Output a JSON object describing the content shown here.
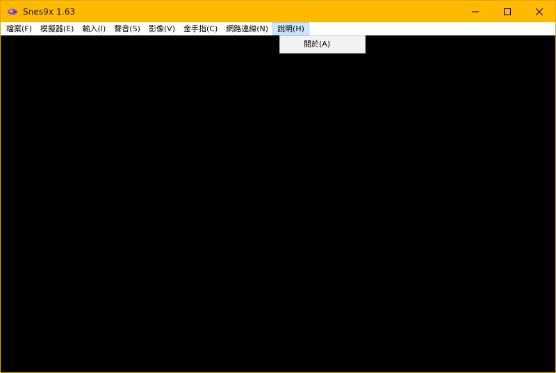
{
  "window": {
    "title": "Snes9x 1.63",
    "icon": "snes9x-app-icon",
    "controls": [
      "minimize-icon",
      "maximize-icon",
      "close-icon"
    ]
  },
  "menubar": {
    "items": [
      {
        "label": "檔案(F)"
      },
      {
        "label": "模擬器(E)"
      },
      {
        "label": "輸入(I)"
      },
      {
        "label": "聲音(S)"
      },
      {
        "label": "影像(V)"
      },
      {
        "label": "金手指(C)"
      },
      {
        "label": "網路連線(N)"
      },
      {
        "label": "說明(H)"
      }
    ],
    "active_index": 7
  },
  "help_menu": {
    "items": [
      {
        "label": "關於(A)"
      }
    ]
  },
  "colors": {
    "titlebar": "#ffb900",
    "menu_highlight": "#cce8ff",
    "screen": "#000000"
  }
}
